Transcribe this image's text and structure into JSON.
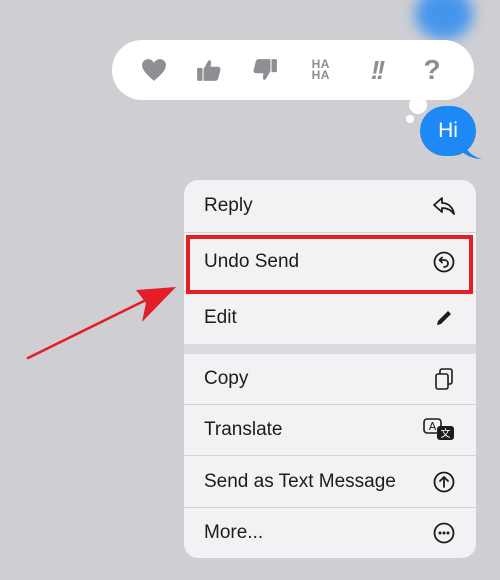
{
  "colors": {
    "background": "#cfcfd3",
    "bubble": "#1e88f5",
    "menu_bg": "#f2f2f4",
    "highlight": "#e41e26",
    "reaction_icon": "#8e8e93"
  },
  "tapback": {
    "reactions": [
      {
        "name": "heart",
        "icon": "heart-icon"
      },
      {
        "name": "like",
        "icon": "thumbs-up-icon"
      },
      {
        "name": "dislike",
        "icon": "thumbs-down-icon"
      },
      {
        "name": "laugh",
        "icon": "haha-icon",
        "text_top": "HA",
        "text_bottom": "HA"
      },
      {
        "name": "emphasize",
        "icon": "double-exclamation-icon",
        "text": "!!"
      },
      {
        "name": "question",
        "icon": "question-icon",
        "text": "?"
      }
    ]
  },
  "message": {
    "text": "Hi"
  },
  "menu": {
    "items": [
      {
        "label": "Reply",
        "icon": "reply-icon"
      },
      {
        "label": "Undo Send",
        "icon": "undo-icon",
        "highlighted": true
      },
      {
        "label": "Edit",
        "icon": "pencil-icon"
      },
      {
        "label": "Copy",
        "icon": "copy-icon"
      },
      {
        "label": "Translate",
        "icon": "translate-icon"
      },
      {
        "label": "Send as Text Message",
        "icon": "arrow-up-circle-icon"
      },
      {
        "label": "More...",
        "icon": "more-icon"
      }
    ]
  },
  "annotation": {
    "arrow_icon": "red-arrow-icon"
  }
}
